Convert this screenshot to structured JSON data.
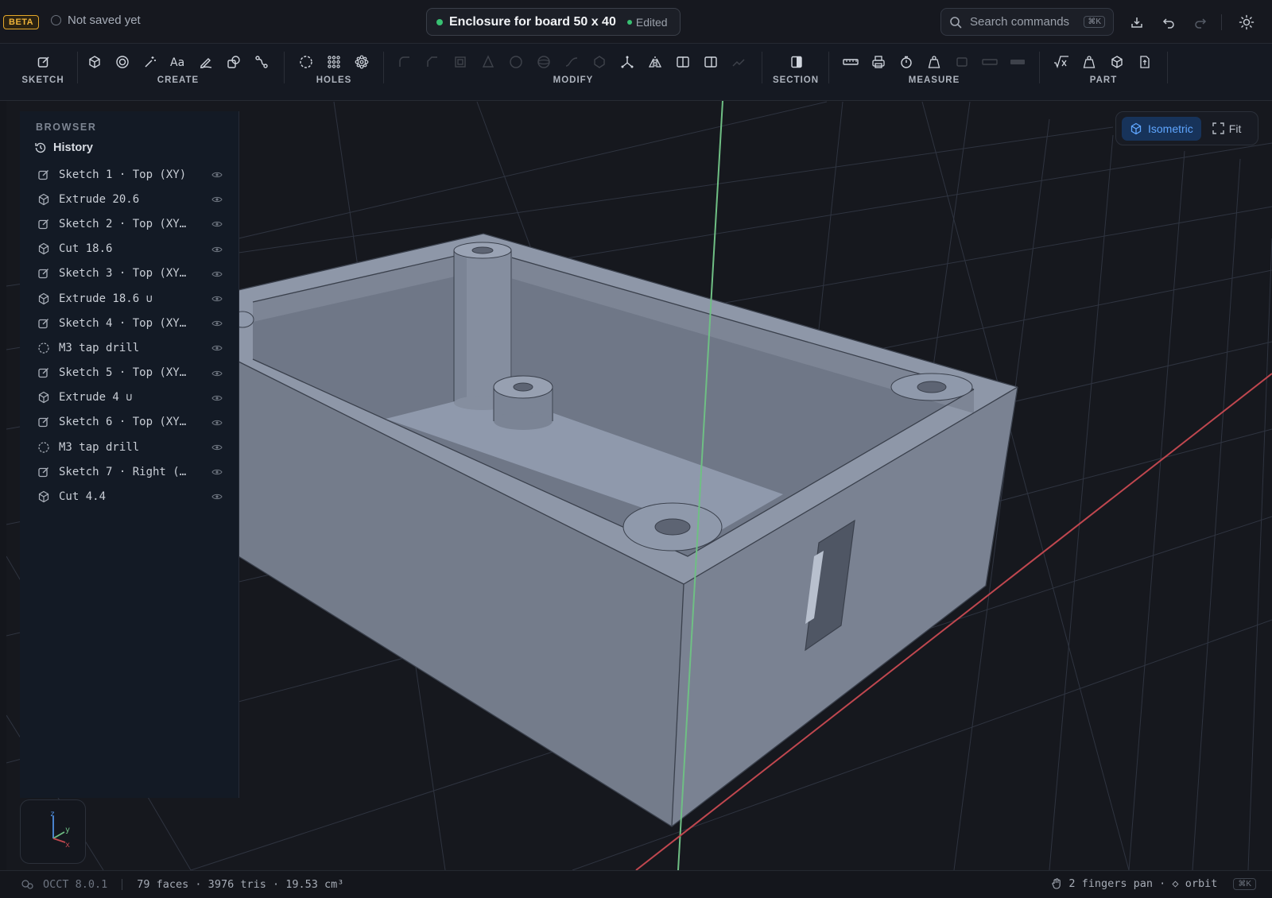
{
  "topbar": {
    "badge": "BETA",
    "save_status": "Not saved yet",
    "document_title": "Enclosure for board 50 x 40",
    "document_state": "Edited",
    "search_placeholder": "Search commands",
    "search_shortcut": "⌘K",
    "icons": [
      "download-icon",
      "undo-icon",
      "redo-icon",
      "theme-sun-icon"
    ]
  },
  "toolbar": {
    "groups": [
      {
        "label": "SKETCH",
        "tools": [
          "sketch-icon"
        ]
      },
      {
        "label": "CREATE",
        "tools": [
          "extrude-icon",
          "revolve-icon",
          "magic-icon",
          "text-icon",
          "freehand-icon",
          "shapes-icon",
          "path-icon"
        ]
      },
      {
        "label": "HOLES",
        "tools": [
          "hole-icon",
          "grid-pattern-icon",
          "circular-pattern-icon"
        ]
      },
      {
        "label": "MODIFY",
        "tools": [
          "fillet-icon",
          "chamfer-icon",
          "shell-icon",
          "draft-icon",
          "boolean-icon",
          "sphere-icon",
          "sweep-icon",
          "loft-icon",
          "transform-icon",
          "mirror-icon",
          "split-icon",
          "split-body-icon",
          "scale-icon"
        ]
      },
      {
        "label": "SECTION",
        "tools": [
          "section-icon"
        ]
      },
      {
        "label": "MEASURE",
        "tools": [
          "ruler-icon",
          "printer-icon",
          "timer-icon",
          "mass-icon",
          "disabled-1",
          "disabled-2",
          "disabled-3"
        ]
      },
      {
        "label": "PART",
        "tools": [
          "parameters-icon",
          "weight-icon",
          "part-icon",
          "export-icon"
        ]
      }
    ]
  },
  "browser": {
    "title": "BROWSER",
    "history_label": "History",
    "items": [
      {
        "icon": "sketch",
        "label": "Sketch 1 · Top (XY)"
      },
      {
        "icon": "extrude",
        "label": "Extrude 20.6"
      },
      {
        "icon": "sketch",
        "label": "Sketch 2 · Top (XY…"
      },
      {
        "icon": "extrude",
        "label": "Cut 18.6"
      },
      {
        "icon": "sketch",
        "label": "Sketch 3 · Top (XY…"
      },
      {
        "icon": "extrude",
        "label": "Extrude 18.6 ∪"
      },
      {
        "icon": "sketch",
        "label": "Sketch 4 · Top (XY…"
      },
      {
        "icon": "hole",
        "label": "M3 tap drill"
      },
      {
        "icon": "sketch",
        "label": "Sketch 5 · Top (XY…"
      },
      {
        "icon": "extrude",
        "label": "Extrude 4 ∪"
      },
      {
        "icon": "sketch",
        "label": "Sketch 6 · Top (XY…"
      },
      {
        "icon": "hole",
        "label": "M3 tap drill"
      },
      {
        "icon": "sketch",
        "label": "Sketch 7 · Right (…"
      },
      {
        "icon": "extrude",
        "label": "Cut 4.4"
      }
    ]
  },
  "viewport": {
    "view_mode": "Isometric",
    "fit_label": "Fit",
    "axes": {
      "z": "z",
      "y": "y",
      "x": "x"
    },
    "colors": {
      "x_axis": "#c0474f",
      "y_axis": "#6fbf84",
      "z_axis": "#4f8fe0",
      "model": "#8a93a5"
    }
  },
  "status": {
    "kernel": "OCCT 8.0.1",
    "stats": "79 faces · 3976 tris · 19.53 cm³",
    "hint": "2 fingers pan · ◇ orbit",
    "shortcut": "⌘K"
  }
}
